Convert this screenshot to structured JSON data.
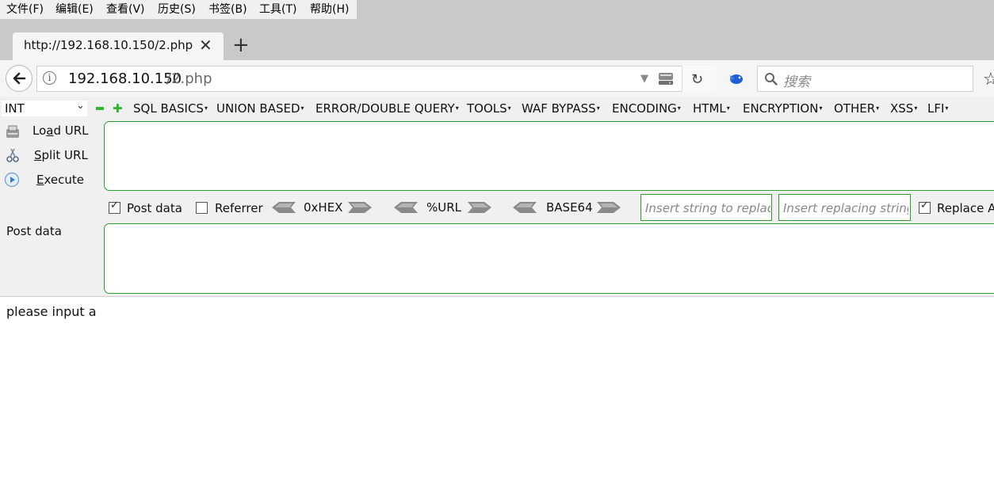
{
  "menubar": {
    "items": [
      "文件(F)",
      "编辑(E)",
      "查看(V)",
      "历史(S)",
      "书签(B)",
      "工具(T)",
      "帮助(H)"
    ]
  },
  "tab": {
    "title": "http://192.168.10.150/2.php",
    "close_glyph": "✕",
    "new_tab_glyph": "+"
  },
  "navbar": {
    "url_host": "192.168.10.150",
    "url_path": "/2.php",
    "search_placeholder": "搜索"
  },
  "hackbar": {
    "type_select": "INT",
    "menus": [
      "SQL BASICS",
      "UNION BASED",
      "ERROR/DOUBLE QUERY",
      "TOOLS",
      "WAF BYPASS",
      "ENCODING",
      "HTML",
      "ENCRYPTION",
      "OTHER",
      "XSS",
      "LFI"
    ],
    "side_buttons": {
      "load_pre": "Lo",
      "load_ul": "a",
      "load_post": "d URL",
      "split_pre": "",
      "split_ul": "S",
      "split_post": "plit URL",
      "execute_pre": "",
      "execute_ul": "E",
      "execute_post": "xecute"
    },
    "options": {
      "post_data": {
        "label": "Post data",
        "checked": true
      },
      "referrer": {
        "label": "Referrer",
        "checked": false
      }
    },
    "encoders": [
      "0xHEX",
      "%URL",
      "BASE64"
    ],
    "replace": {
      "find_placeholder": "Insert string to replace",
      "replace_placeholder": "Insert replacing string",
      "replace_all_label": "Replace A",
      "replace_all_checked": true
    },
    "post_data_label": "Post data"
  },
  "page": {
    "output": "please input a"
  },
  "colors": {
    "chrome_bg": "#c9c9c9",
    "toolbar_bg": "#f5f5f5",
    "hackbar_border": "#2f9e2f",
    "hackbar_green": "#2fb52f"
  }
}
